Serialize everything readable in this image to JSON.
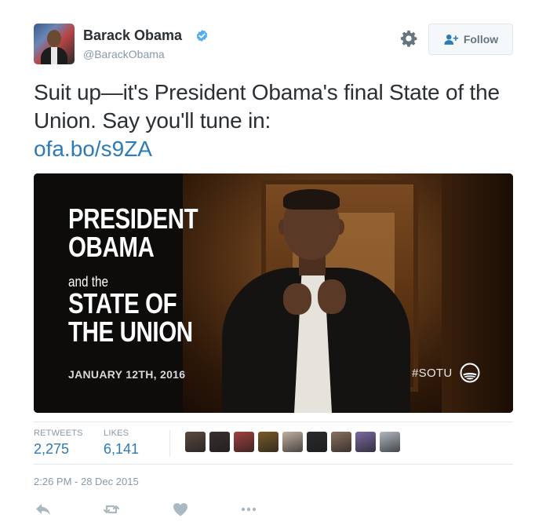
{
  "author": {
    "name": "Barack Obama",
    "handle": "@BarackObama"
  },
  "follow_button": {
    "label": "Follow"
  },
  "tweet": {
    "text": "Suit up—it's President Obama's final State of the Union. Say you'll tune in:",
    "link": "ofa.bo/s9ZA"
  },
  "media": {
    "title_line1": "PRESIDENT",
    "title_line2": "OBAMA",
    "subtitle": "and the",
    "title_line3": "STATE OF",
    "title_line4": "THE UNION",
    "date": "JANUARY 12TH, 2016",
    "hashtag": "#SOTU"
  },
  "stats": {
    "retweets_label": "RETWEETS",
    "retweets_value": "2,275",
    "likes_label": "LIKES",
    "likes_value": "6,141"
  },
  "liker_avatar_colors": [
    "#5a4a40",
    "#3a3030",
    "#a04040",
    "#7a5a2a",
    "#c0b0a0",
    "#2a2a2a",
    "#8a7060",
    "#7a6aa0",
    "#b0b8c0"
  ],
  "timestamp": "2:26 PM - 28 Dec 2015",
  "colors": {
    "link": "#2b7bb9",
    "verified": "#55acee",
    "muted": "#8899a6",
    "text": "#292f33"
  },
  "icons": {
    "verified": "verified-badge-icon",
    "settings": "gear-icon",
    "follow": "add-user-icon",
    "reply": "reply-icon",
    "retweet": "retweet-icon",
    "like": "heart-icon",
    "more": "more-dots-icon"
  }
}
